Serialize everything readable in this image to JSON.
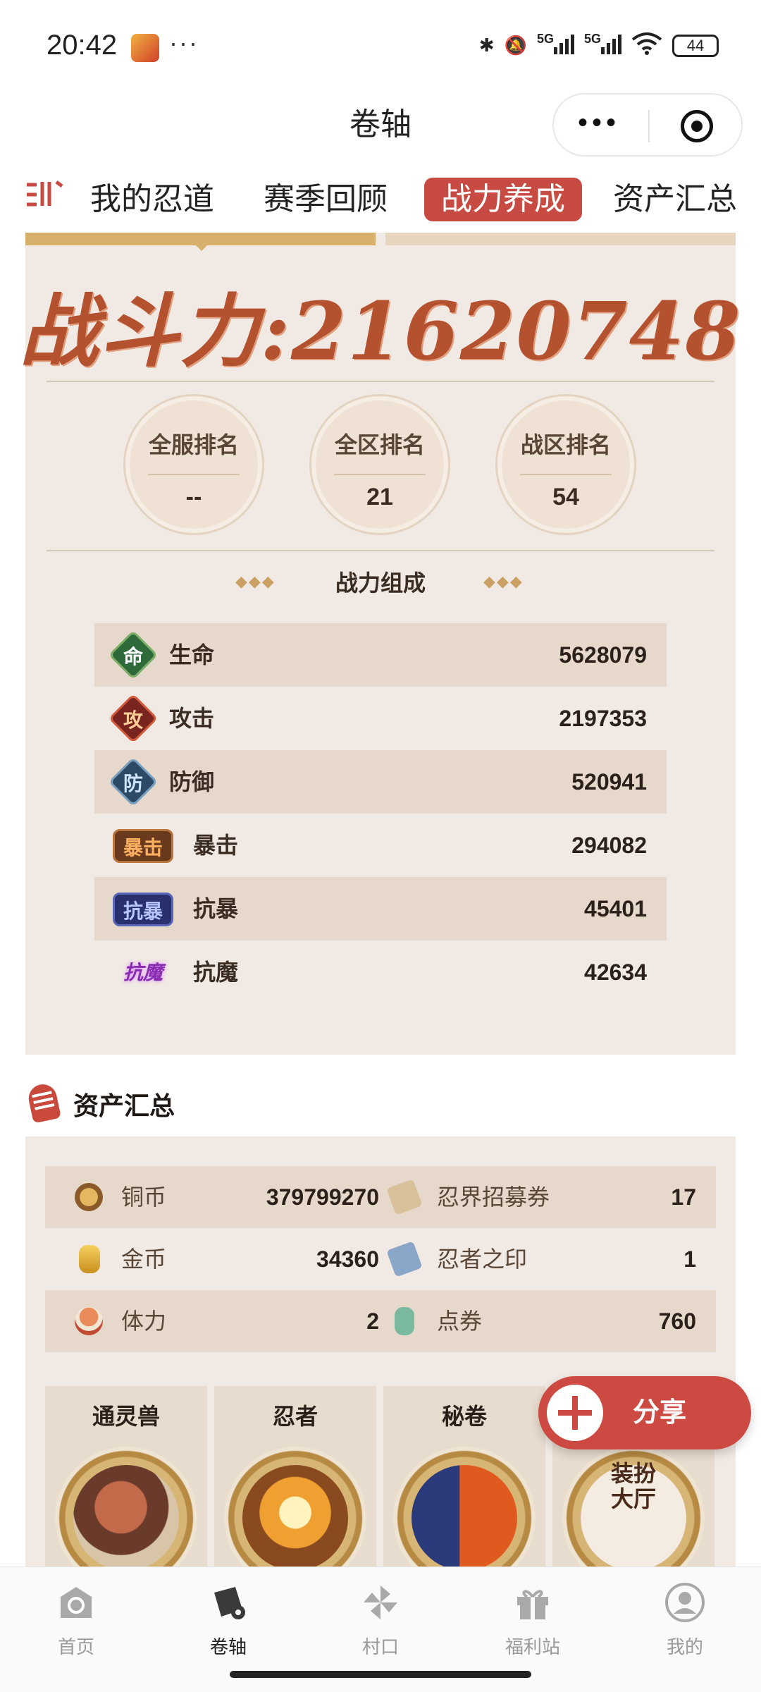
{
  "status_bar": {
    "time": "20:42",
    "extra": "···",
    "net1": "5G",
    "net2": "5G",
    "battery": "44"
  },
  "header": {
    "title": "卷轴",
    "more_icon": "more-dots-icon",
    "close_icon": "target-circle-icon"
  },
  "tabs": [
    {
      "label": "我的忍道"
    },
    {
      "label": "赛季回顾"
    },
    {
      "label": "战力养成"
    },
    {
      "label": "资产汇总"
    }
  ],
  "power": {
    "label": "战斗力:",
    "value": "21620748"
  },
  "ranks": [
    {
      "label": "全服排名",
      "value": "--"
    },
    {
      "label": "全区排名",
      "value": "21"
    },
    {
      "label": "战区排名",
      "value": "54"
    }
  ],
  "composition": {
    "title": "战力组成",
    "diamonds": "◆◆◆",
    "rows": [
      {
        "badge": "命",
        "label": "生命",
        "value": "5628079"
      },
      {
        "badge": "攻",
        "label": "攻击",
        "value": "2197353"
      },
      {
        "badge": "防",
        "label": "防御",
        "value": "520941"
      },
      {
        "badge": "暴击",
        "label": "暴击",
        "value": "294082"
      },
      {
        "badge": "抗暴",
        "label": "抗暴",
        "value": "45401"
      },
      {
        "badge": "抗魔",
        "label": "抗魔",
        "value": "42634"
      }
    ]
  },
  "assets": {
    "title": "资产汇总",
    "rows": [
      {
        "left_label": "铜币",
        "left_value": "379799270",
        "right_label": "忍界招募券",
        "right_value": "17"
      },
      {
        "left_label": "金币",
        "left_value": "34360",
        "right_label": "忍者之印",
        "right_value": "1"
      },
      {
        "left_label": "体力",
        "left_value": "2",
        "right_label": "点券",
        "right_value": "760"
      }
    ],
    "cards": [
      {
        "title": "通灵兽"
      },
      {
        "title": "忍者"
      },
      {
        "title": "秘卷"
      },
      {
        "title": "装扮大厅"
      }
    ]
  },
  "share": {
    "label": "分享"
  },
  "nav": [
    {
      "label": "首页"
    },
    {
      "label": "卷轴"
    },
    {
      "label": "村口"
    },
    {
      "label": "福利站"
    },
    {
      "label": "我的"
    }
  ]
}
